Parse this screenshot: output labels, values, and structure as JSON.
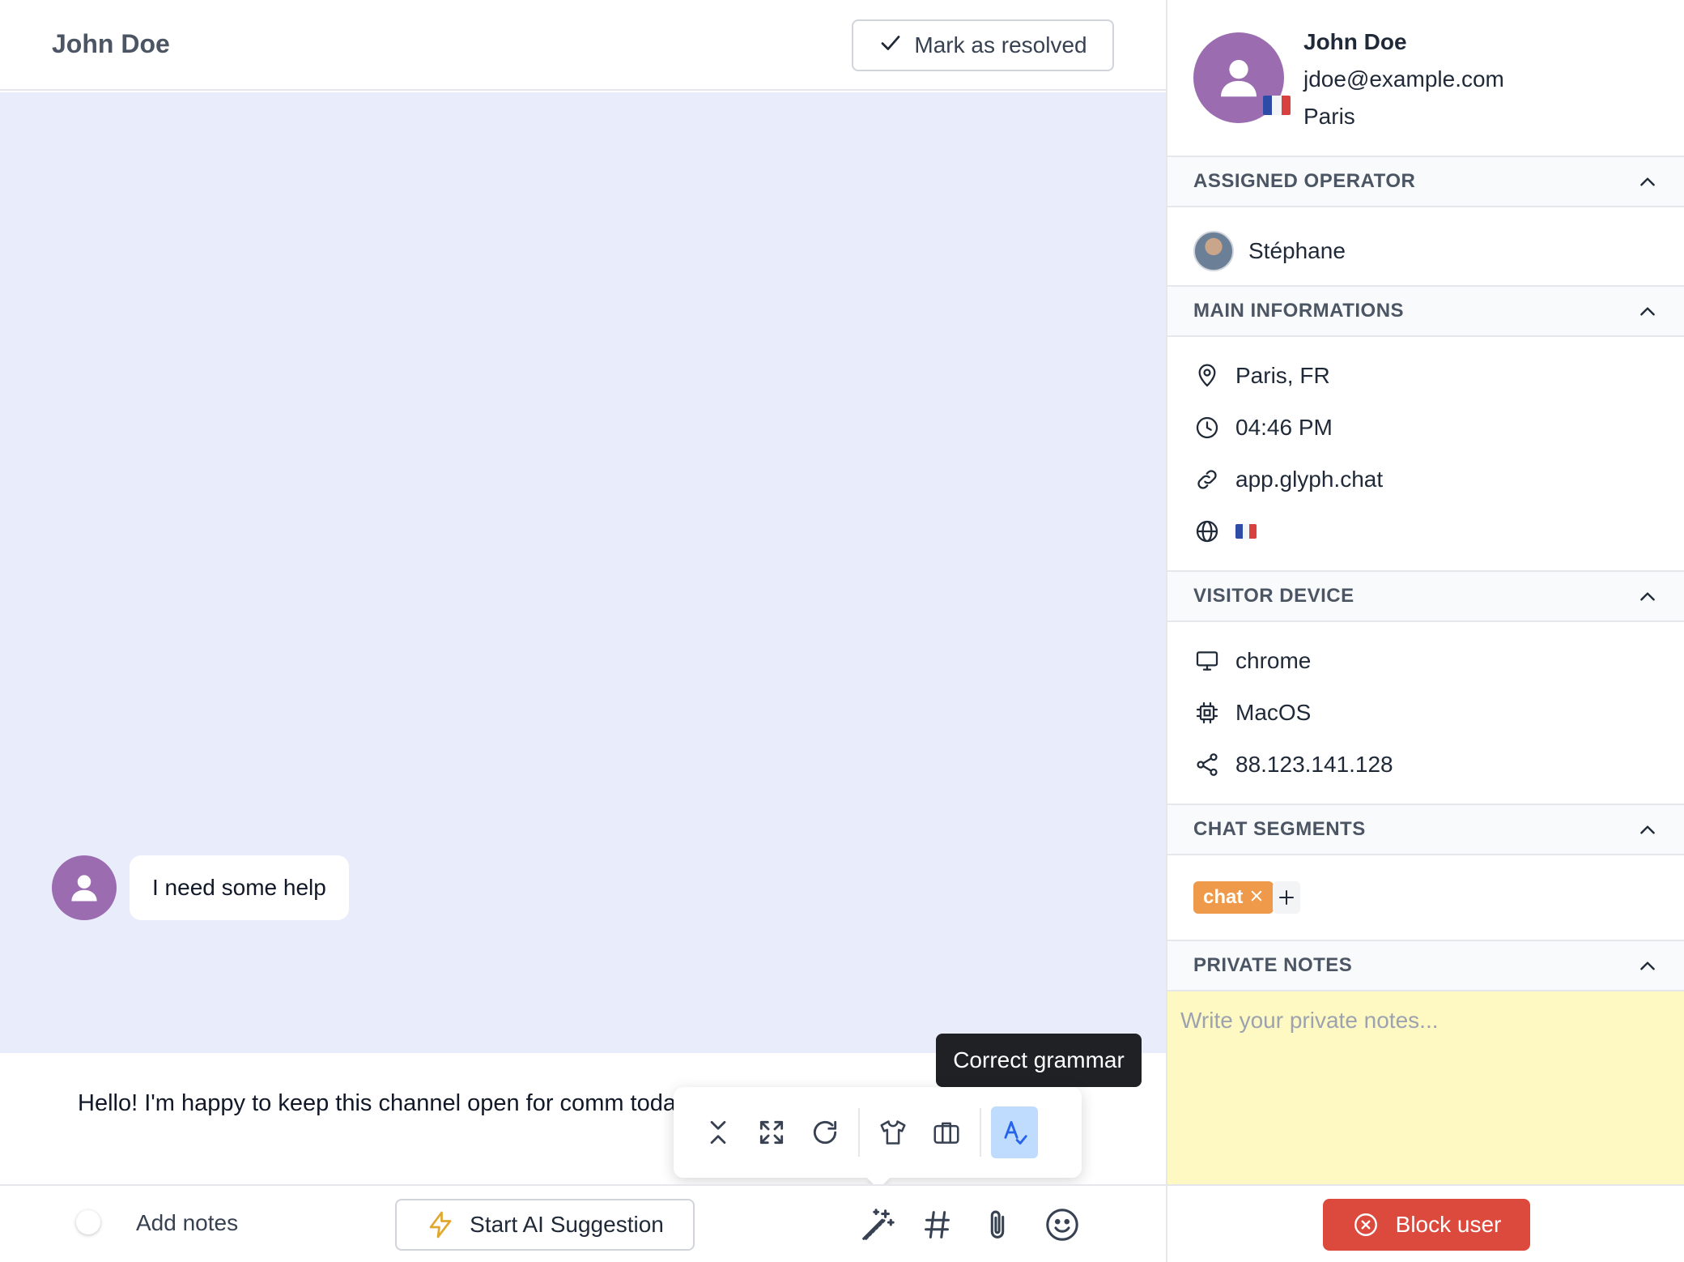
{
  "conversation": {
    "title": "John Doe",
    "resolve_label": "Mark as resolved"
  },
  "messages": [
    {
      "text": "I need some help"
    }
  ],
  "composer": {
    "text": "Hello! I'm happy to keep this channel open for comm today?"
  },
  "tooltip": {
    "text": "Correct grammar"
  },
  "bottom_bar": {
    "add_notes_label": "Add notes",
    "ai_button_label": "Start AI Suggestion"
  },
  "profile": {
    "name": "John Doe",
    "email": "jdoe@example.com",
    "city": "Paris"
  },
  "sections": {
    "assigned_operator": {
      "title": "ASSIGNED OPERATOR",
      "operator_name": "Stéphane"
    },
    "main_informations": {
      "title": "MAIN INFORMATIONS",
      "location": "Paris, FR",
      "time": "04:46 PM",
      "website": "app.glyph.chat"
    },
    "visitor_device": {
      "title": "VISITOR DEVICE",
      "browser": "chrome",
      "os": "MacOS",
      "ip": "88.123.141.128"
    },
    "chat_segments": {
      "title": "CHAT SEGMENTS",
      "tags": [
        "chat"
      ]
    },
    "private_notes": {
      "title": "PRIVATE NOTES",
      "placeholder": "Write your private notes..."
    }
  },
  "block_user_label": "Block user",
  "colors": {
    "chat_background": "#e8ecfb",
    "avatar": "#9b6db0",
    "tag_orange": "#ef9a4a",
    "block_red": "#dc4a3d",
    "notes_yellow": "#fef9c3",
    "active_tool": "#bfdbfe"
  }
}
